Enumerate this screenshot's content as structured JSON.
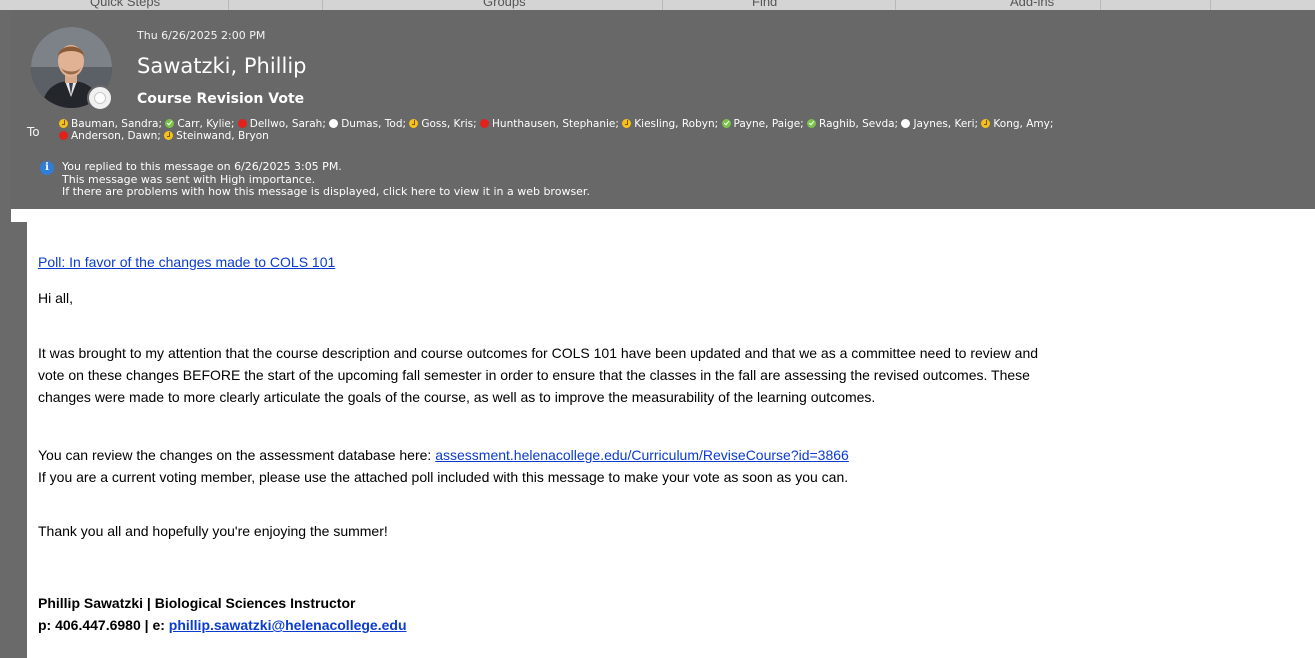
{
  "ribbon": {
    "groups": [
      "Quick Steps",
      "Groups",
      "Find",
      "Add-ins"
    ]
  },
  "header": {
    "date": "Thu 6/26/2025 2:00 PM",
    "sender": "Sawatzki, Phillip",
    "subject": "Course Revision Vote",
    "to_label": "To",
    "recipients": [
      {
        "name": "Bauman, Sandra;",
        "status": "away"
      },
      {
        "name": "Carr, Kylie;",
        "status": "available"
      },
      {
        "name": "Dellwo, Sarah;",
        "status": "busy"
      },
      {
        "name": "Dumas, Tod;",
        "status": "offline"
      },
      {
        "name": "Goss, Kris;",
        "status": "away"
      },
      {
        "name": "Hunthausen, Stephanie;",
        "status": "busy"
      },
      {
        "name": "Kiesling, Robyn;",
        "status": "away"
      },
      {
        "name": "Payne, Paige;",
        "status": "available"
      },
      {
        "name": "Raghib, Sevda;",
        "status": "available"
      },
      {
        "name": "Jaynes, Keri;",
        "status": "offline"
      },
      {
        "name": "Kong, Amy;",
        "status": "away"
      },
      {
        "name": "Anderson, Dawn;",
        "status": "busy"
      },
      {
        "name": "Steinwand, Bryon",
        "status": "away"
      }
    ],
    "info": {
      "replied": "You replied to this message on 6/26/2025 3:05 PM.",
      "importance": "This message was sent with High importance.",
      "display_problem": "If there are problems with how this message is displayed, click here to view it in a web browser."
    }
  },
  "body": {
    "poll_link": "Poll: In favor of the changes made to COLS 101",
    "greeting": "Hi all,",
    "paragraph1_lines": [
      "It was brought to my attention that the course description and course outcomes for COLS 101 have been updated and that we as a committee need to review and",
      "vote on these changes BEFORE the start of the upcoming fall semester in order to ensure that the classes in the fall are assessing the revised outcomes. These",
      "changes were made to more clearly articulate the goals of the course, as well as to improve the measurability of the learning outcomes."
    ],
    "review_text": "You can review the changes on the assessment database here: ",
    "review_link": "assessment.helenacollege.edu/Curriculum/ReviseCourse?id=3866",
    "voting_text": "If you are a current voting member, please use the attached poll included with this message to make your vote as soon as you can.",
    "thanks": "Thank you all and hopefully you're enjoying the summer!",
    "signature": {
      "name_title": "Phillip Sawatzki | Biological Sciences Instructor",
      "phone_prefix": "p: 406.447.6980 | e: ",
      "email": "phillip.sawatzki@helenacollege.edu"
    }
  },
  "colors": {
    "header_bg": "#686868",
    "link": "#0b3cd0",
    "away": "#f5c019",
    "available": "#7bc34a",
    "busy": "#e0211c",
    "offline": "#ffffff"
  }
}
